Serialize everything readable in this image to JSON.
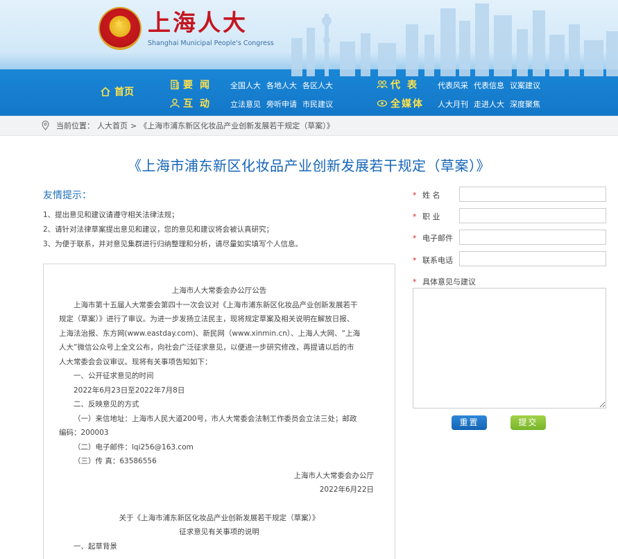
{
  "header": {
    "site_title": "上海人大",
    "site_subtitle": "Shanghai Municipal People's Congress"
  },
  "nav": {
    "home_label": "首页",
    "yaowen_label": "要闻",
    "yaowen_links": [
      "全国人大",
      "各地人大",
      "各区人大"
    ],
    "hudong_label": "互动",
    "hudong_links": [
      "立法意见",
      "旁听申请",
      "市民建议"
    ],
    "daibiao_label": "代表",
    "daibiao_links": [
      "代表风采",
      "代表信息",
      "议案建议"
    ],
    "quanmeiti_label": "全媒体",
    "quanmeiti_links": [
      "人大月刊",
      "走进人大",
      "深度聚焦"
    ]
  },
  "breadcrumb": {
    "prefix": "当前位置：",
    "home": "人大首页",
    "separator": ">",
    "current": "《上海市浦东新区化妆品产业创新发展若干规定（草案）》"
  },
  "page_title": "《上海市浦东新区化妆品产业创新发展若干规定（草案）》",
  "tips": {
    "heading": "友情提示：",
    "items": [
      "1、提出意见和建议请遵守相关法律法规；",
      "2、请针对法律草案提出意见和建议，您的意见和建议将会被认真研究；",
      "3、为便于联系，并对意见集群进行归纳整理和分析，请尽量如实填写个人信息。"
    ]
  },
  "notice": {
    "title": "上海市人大常委会办公厅公告",
    "body_lines": [
      "上海市第十五届人大常委会第四十一次会议对《上海市浦东新区化妆品产业创新发展若干",
      "规定（草案）》进行了审议。为进一步发扬立法民主，现将规定草案及相关说明在解放日报、",
      "上海法治报、东方网(www.eastday.com)、新民网（www.xinmin.cn）、上海人大网、“上海",
      "人大”微信公众号上全文公布，向社会广泛征求意见，以便进一步研究修改，再提请以后的市",
      "人大常委会会议审议。现将有关事项告知如下："
    ],
    "section1_heading": "一、公开征求意见的时间",
    "section1_dates": "2022年6月23日至2022年7月8日",
    "section2_heading": "二、反映意见的方式",
    "mail_line1": "（一）来信地址：上海市人民大道200号，市人大常委会法制工作委员会立法三处；邮政",
    "mail_line2": "编码：200003",
    "email_line": "（二）电子邮件：lqi256@163.com",
    "fax_line": "（三）传 真：63586556",
    "sign_org": "上海市人大常委会办公厅",
    "sign_date": "2022年6月22日",
    "explain_title1": "关于《上海市浦东新区化妆品产业创新发展若干规定（草案）》",
    "explain_title2": "征求意见有关事项的说明",
    "explain_section1": "一、起草背景"
  },
  "form": {
    "required_mark": "*",
    "name_label": "姓 名",
    "job_label": "职 业",
    "email_label": "电子邮件",
    "phone_label": "联系电话",
    "opinion_label": "具体意见与建议",
    "reset_label": "重置",
    "submit_label": "提交"
  },
  "colors": {
    "nav_blue": "#1477c8",
    "nav_yellow": "#ffe34a",
    "title_red": "#c41620",
    "title_blue": "#1565b8",
    "reset_blue": "#1a70c0",
    "submit_green": "#8cc43a",
    "required_red": "#d9231c"
  }
}
